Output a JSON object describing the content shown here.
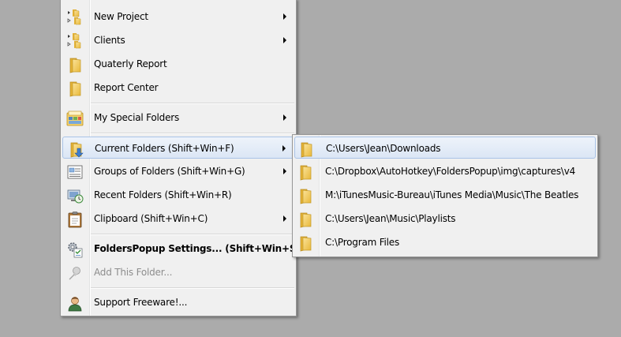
{
  "main_menu": {
    "items": [
      {
        "label": "New Project",
        "icon": "folder-tree-icon",
        "submenu": true
      },
      {
        "label": "Clients",
        "icon": "folder-tree-icon",
        "submenu": true
      },
      {
        "label": "Quaterly Report",
        "icon": "folder-icon",
        "submenu": false
      },
      {
        "label": "Report Center",
        "icon": "folder-icon",
        "submenu": false
      },
      {
        "label": "My Special Folders",
        "icon": "special-folders-icon",
        "submenu": true
      },
      {
        "label": "Current Folders (Shift+Win+F)",
        "icon": "current-folders-icon",
        "submenu": true,
        "highlighted": true
      },
      {
        "label": "Groups of Folders (Shift+Win+G)",
        "icon": "groups-icon",
        "submenu": true
      },
      {
        "label": "Recent Folders (Shift+Win+R)",
        "icon": "recent-folders-icon",
        "submenu": false
      },
      {
        "label": "Clipboard (Shift+Win+C)",
        "icon": "clipboard-icon",
        "submenu": true
      },
      {
        "label": "FoldersPopup Settings... (Shift+Win+S)",
        "icon": "settings-icon",
        "submenu": false,
        "bold": true
      },
      {
        "label": "Add This Folder...",
        "icon": "pin-icon",
        "submenu": false,
        "disabled": true
      },
      {
        "label": "Support Freeware!...",
        "icon": "support-user-icon",
        "submenu": false
      }
    ]
  },
  "sub_menu": {
    "items": [
      {
        "label": "C:\\Users\\Jean\\Downloads",
        "icon": "folder-icon"
      },
      {
        "label": "C:\\Dropbox\\AutoHotkey\\FoldersPopup\\img\\captures\\v4",
        "icon": "folder-icon"
      },
      {
        "label": "M:\\iTunesMusic-Bureau\\iTunes Media\\Music\\The Beatles",
        "icon": "folder-icon"
      },
      {
        "label": "C:\\Users\\Jean\\Music\\Playlists",
        "icon": "folder-icon"
      },
      {
        "label": "C:\\Program Files",
        "icon": "folder-icon"
      }
    ]
  },
  "colors": {
    "desktop": "#ababab",
    "menu_bg": "#f0f0f0",
    "highlight_border": "#a9c3e7",
    "folder": "#f3c84a"
  }
}
